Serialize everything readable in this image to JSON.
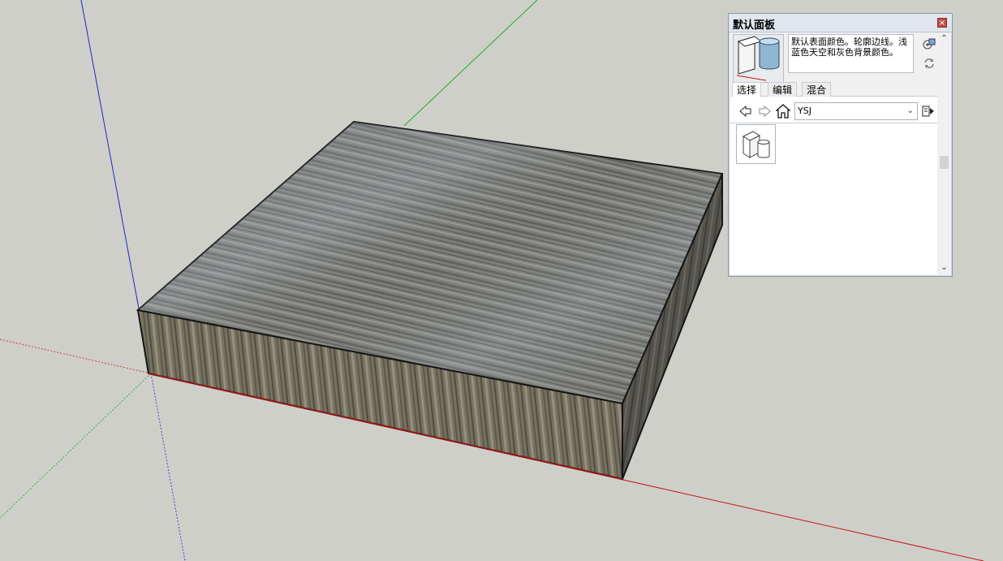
{
  "panel": {
    "title": "默认面板",
    "close_glyph": "×",
    "style_description": "默认表面颜色。轮廓边线。浅蓝色天空和灰色背景颜色。",
    "tabs": [
      {
        "label": "选择",
        "active": true
      },
      {
        "label": "编辑",
        "active": false
      },
      {
        "label": "混合",
        "active": false
      }
    ],
    "collection_select": {
      "value": "YSJ"
    },
    "icons": {
      "back": "back-arrow-icon",
      "forward": "forward-arrow-icon",
      "home": "home-icon",
      "details": "details-menu-icon",
      "create": "create-style-icon",
      "update": "update-style-icon"
    }
  },
  "colors": {
    "background": "#cfcfca",
    "red_axis": "#d01010",
    "green_axis": "#10b010",
    "blue_axis": "#1020c0",
    "wood_top": "#7b7d79",
    "wood_front": "#6e6a60",
    "wood_side": "#4e4c47"
  }
}
